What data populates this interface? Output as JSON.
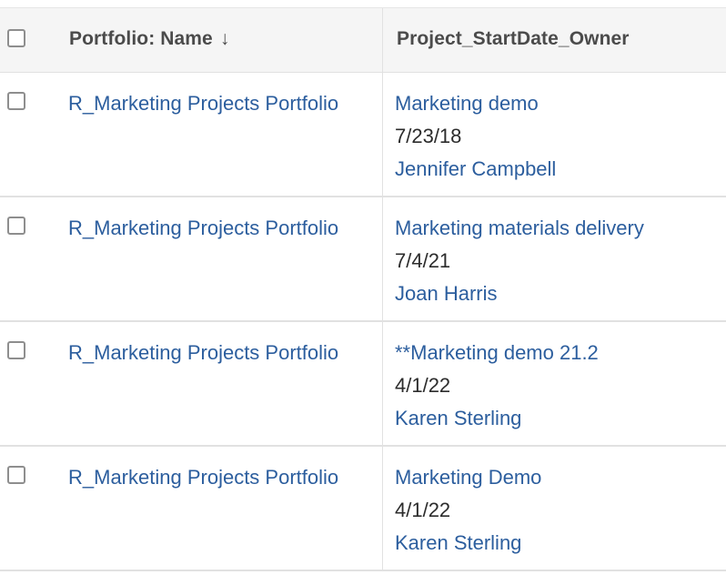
{
  "header": {
    "name_column": "Portfolio: Name",
    "sort_indicator": "↓",
    "project_column": "Project_StartDate_Owner"
  },
  "rows": [
    {
      "portfolio": "R_Marketing Projects Portfolio",
      "project": "Marketing demo",
      "start_date": "7/23/18",
      "owner": "Jennifer Campbell"
    },
    {
      "portfolio": "R_Marketing Projects Portfolio",
      "project": "Marketing materials delivery",
      "start_date": "7/4/21",
      "owner": "Joan Harris"
    },
    {
      "portfolio": "R_Marketing Projects Portfolio",
      "project": "**Marketing demo 21.2",
      "start_date": "4/1/22",
      "owner": "Karen Sterling"
    },
    {
      "portfolio": "R_Marketing Projects Portfolio",
      "project": "Marketing Demo",
      "start_date": "4/1/22",
      "owner": "Karen Sterling"
    }
  ],
  "colors": {
    "link": "#2c5e9e",
    "header_bg": "#f5f5f5",
    "border": "#e1e1e1"
  }
}
